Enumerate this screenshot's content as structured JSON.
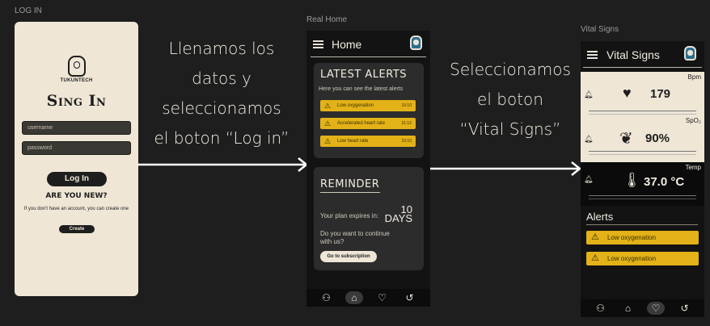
{
  "frame_labels": {
    "login": "LOG IN",
    "home": "Real Home",
    "vital": "Vital Signs"
  },
  "captions": {
    "first": [
      "Llenamos los",
      "datos y",
      "seleccionamos",
      "el boton “Log in”"
    ],
    "second": [
      "Seleccionamos",
      "el boton",
      "“Vital Signs”"
    ]
  },
  "login": {
    "brand": "TUKUNTECH",
    "title": "Sing In",
    "username_placeholder": "username",
    "password_placeholder": "password",
    "login_button": "Log In",
    "new_heading": "ARE YOU NEW?",
    "hint": "If you don't have an account, you can create one",
    "create_button": "Create"
  },
  "home": {
    "header_title": "Home",
    "alerts_title": "LATEST ALERTS",
    "alerts_subtitle": "Here you can see the latest alerts",
    "alerts": [
      {
        "label": "Low oxygenation",
        "time": "10:10"
      },
      {
        "label": "Accelerated heart rate",
        "time": "21:12"
      },
      {
        "label": "Low heart rate",
        "time": "23:10"
      }
    ],
    "reminder_title": "REMINDER",
    "expires_label": "Your plan expires in:",
    "days_number": "10",
    "days_label": "DAYS",
    "continue_question": "Do you want to continue with us?",
    "subscription_button": "Go to subscription"
  },
  "vital": {
    "header_title": "Vital Signs",
    "bpm_unit": "Bpm",
    "bpm_value": "179",
    "spo2_unit": "SpO₂",
    "spo2_value": "90%",
    "temp_unit": "Temp",
    "temp_value": "37.0 °C",
    "alerts_title": "Alerts",
    "alerts": [
      {
        "label": "Low oxygenation"
      },
      {
        "label": "Low oxygenation"
      }
    ]
  },
  "icons": {
    "nav": [
      "profile-heart-icon",
      "home-icon",
      "heart-rate-icon",
      "history-icon"
    ],
    "alert": "warning-icon",
    "bell": "bell-icon"
  },
  "colors": {
    "background": "#1e1e1e",
    "cream": "#efe6d6",
    "alert_yellow": "#e3b218",
    "phone": "#131313"
  }
}
